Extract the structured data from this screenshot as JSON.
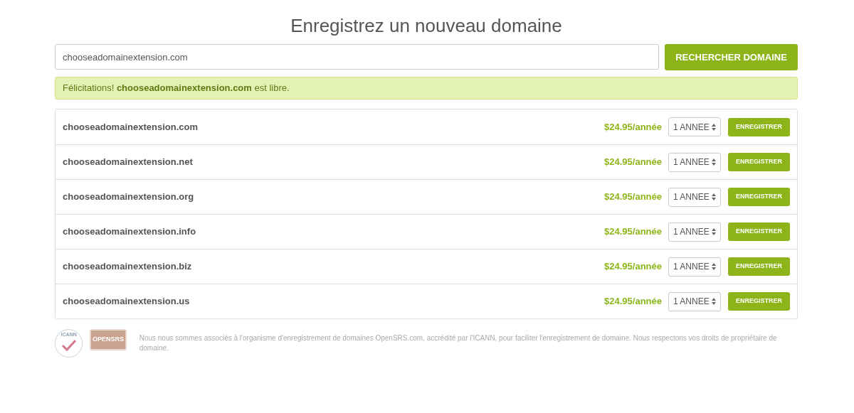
{
  "title": "Enregistrez un nouveau domaine",
  "search": {
    "value": "chooseadomainextension.com",
    "button": "RECHERCHER DOMAINE"
  },
  "alert": "Félicitations! **chooseadomainextension.com** est libre.",
  "results": [
    {
      "domain": "chooseadomainextension.com",
      "price": "$24.95/année",
      "period": "1 ANNEE",
      "button": "ENREGISTRER"
    },
    {
      "domain": "chooseadomainextension.net",
      "price": "$24.95/année",
      "period": "1 ANNEE",
      "button": "ENREGISTRER"
    },
    {
      "domain": "chooseadomainextension.org",
      "price": "$24.95/année",
      "period": "1 ANNEE",
      "button": "ENREGISTRER"
    },
    {
      "domain": "chooseadomainextension.info",
      "price": "$24.95/année",
      "period": "1 ANNEE",
      "button": "ENREGISTRER"
    },
    {
      "domain": "chooseadomainextension.biz",
      "price": "$24.95/année",
      "period": "1 ANNEE",
      "button": "ENREGISTRER"
    },
    {
      "domain": "chooseadomainextension.us",
      "price": "$24.95/année",
      "period": "1 ANNEE",
      "button": "ENREGISTRER"
    }
  ],
  "footer": {
    "logos": [
      {
        "kind": "icann",
        "text": "ICANN"
      },
      {
        "kind": "opensrs",
        "text": "OPENSRS"
      }
    ],
    "text": "Nous nous sommes associés à l'organisme d'enregistrement de domaines OpenSRS.com, accrédité par l'ICANN, pour faciliter l'enregistrement de domaine. Nous respectons vos droits de propriétaire de domaine."
  }
}
